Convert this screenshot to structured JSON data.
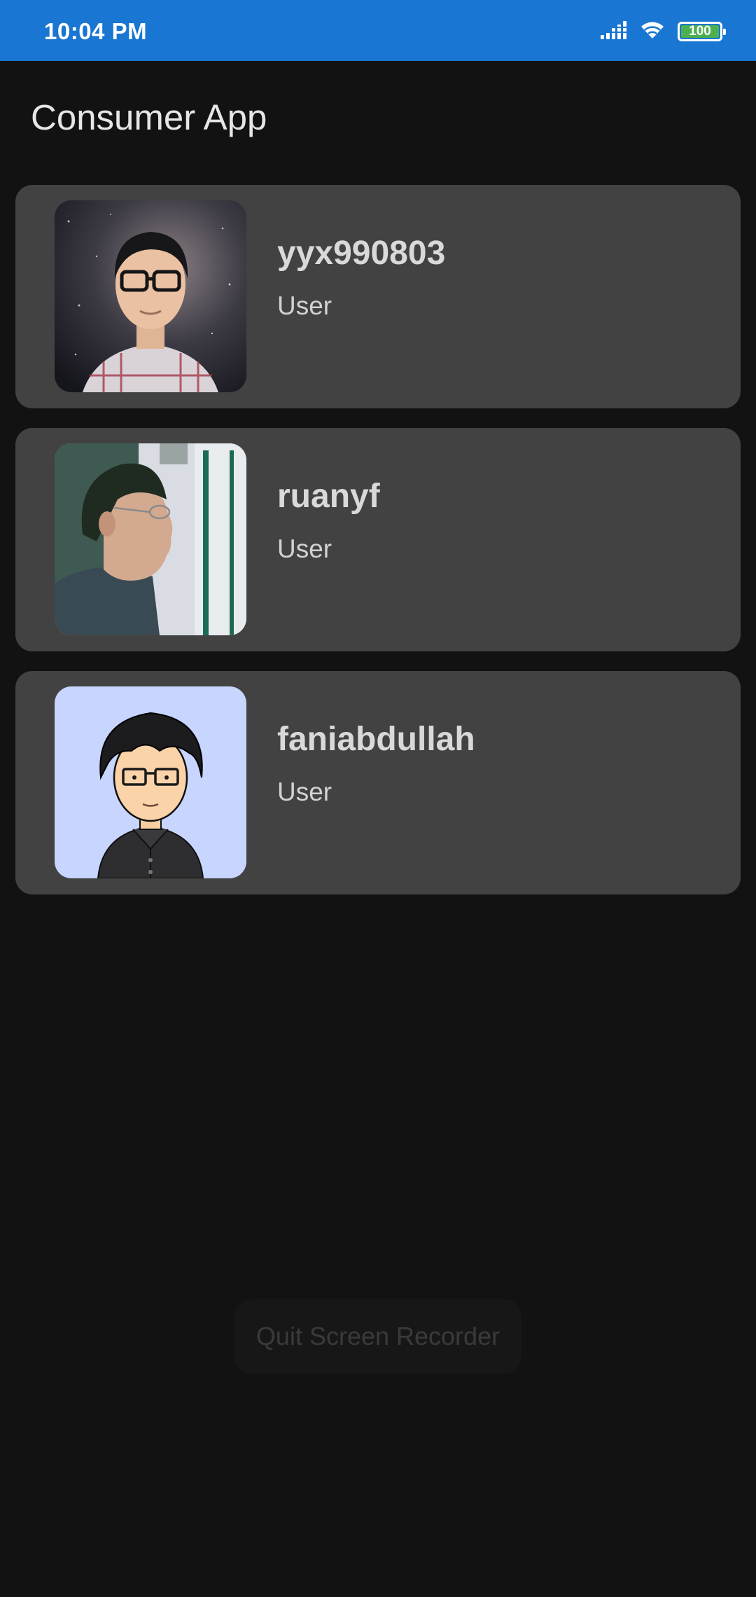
{
  "status_bar": {
    "time": "10:04 PM",
    "battery_level": "100",
    "battery_fraction": 1.0,
    "icons": [
      "signal-icon",
      "wifi-icon",
      "battery-icon"
    ],
    "background_color": "#1976d2"
  },
  "app": {
    "title": "Consumer App",
    "background_color": "#121212",
    "card_color": "#424242"
  },
  "users": [
    {
      "username": "yyx990803",
      "role": "User",
      "avatar": "photo-avatar"
    },
    {
      "username": "ruanyf",
      "role": "User",
      "avatar": "photo-avatar"
    },
    {
      "username": "faniabdullah",
      "role": "User",
      "avatar": "cartoon-avatar"
    }
  ],
  "overlay": {
    "quit_label": "Quit Screen Recorder"
  }
}
